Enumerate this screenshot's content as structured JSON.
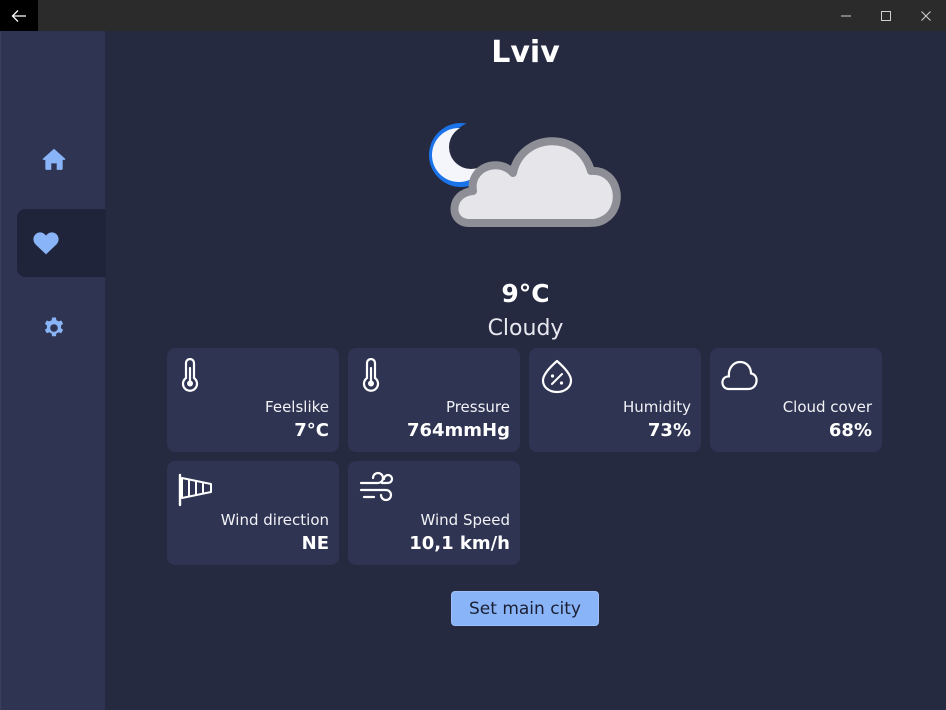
{
  "main": {
    "city": "Lviv",
    "weather_icon": "moon-cloud-icon",
    "temperature": "9°C",
    "condition": "Cloudy",
    "cards": [
      {
        "icon": "thermometer-icon",
        "label": "Feelslike",
        "value": "7°C"
      },
      {
        "icon": "thermometer-icon",
        "label": "Pressure",
        "value": "764mmHg"
      },
      {
        "icon": "humidity-drop-icon",
        "label": "Humidity",
        "value": "73%"
      },
      {
        "icon": "cloud-outline-icon",
        "label": "Cloud cover",
        "value": "68%"
      },
      {
        "icon": "windsock-icon",
        "label": "Wind direction",
        "value": "NE"
      },
      {
        "icon": "wind-icon",
        "label": "Wind Speed",
        "value": "10,1 km/h"
      }
    ],
    "set_main_city_label": "Set main city"
  },
  "sidebar": {
    "items": [
      {
        "icon": "home-icon",
        "active": false
      },
      {
        "icon": "heart-icon",
        "active": true
      },
      {
        "icon": "gear-icon",
        "active": false
      }
    ]
  },
  "colors": {
    "background": "#262a40",
    "sidebar": "#2e3452",
    "card": "#2e3452",
    "accent": "#8ab4f8",
    "moon": "#1a73e8",
    "cloud": "#e6e6ea"
  }
}
